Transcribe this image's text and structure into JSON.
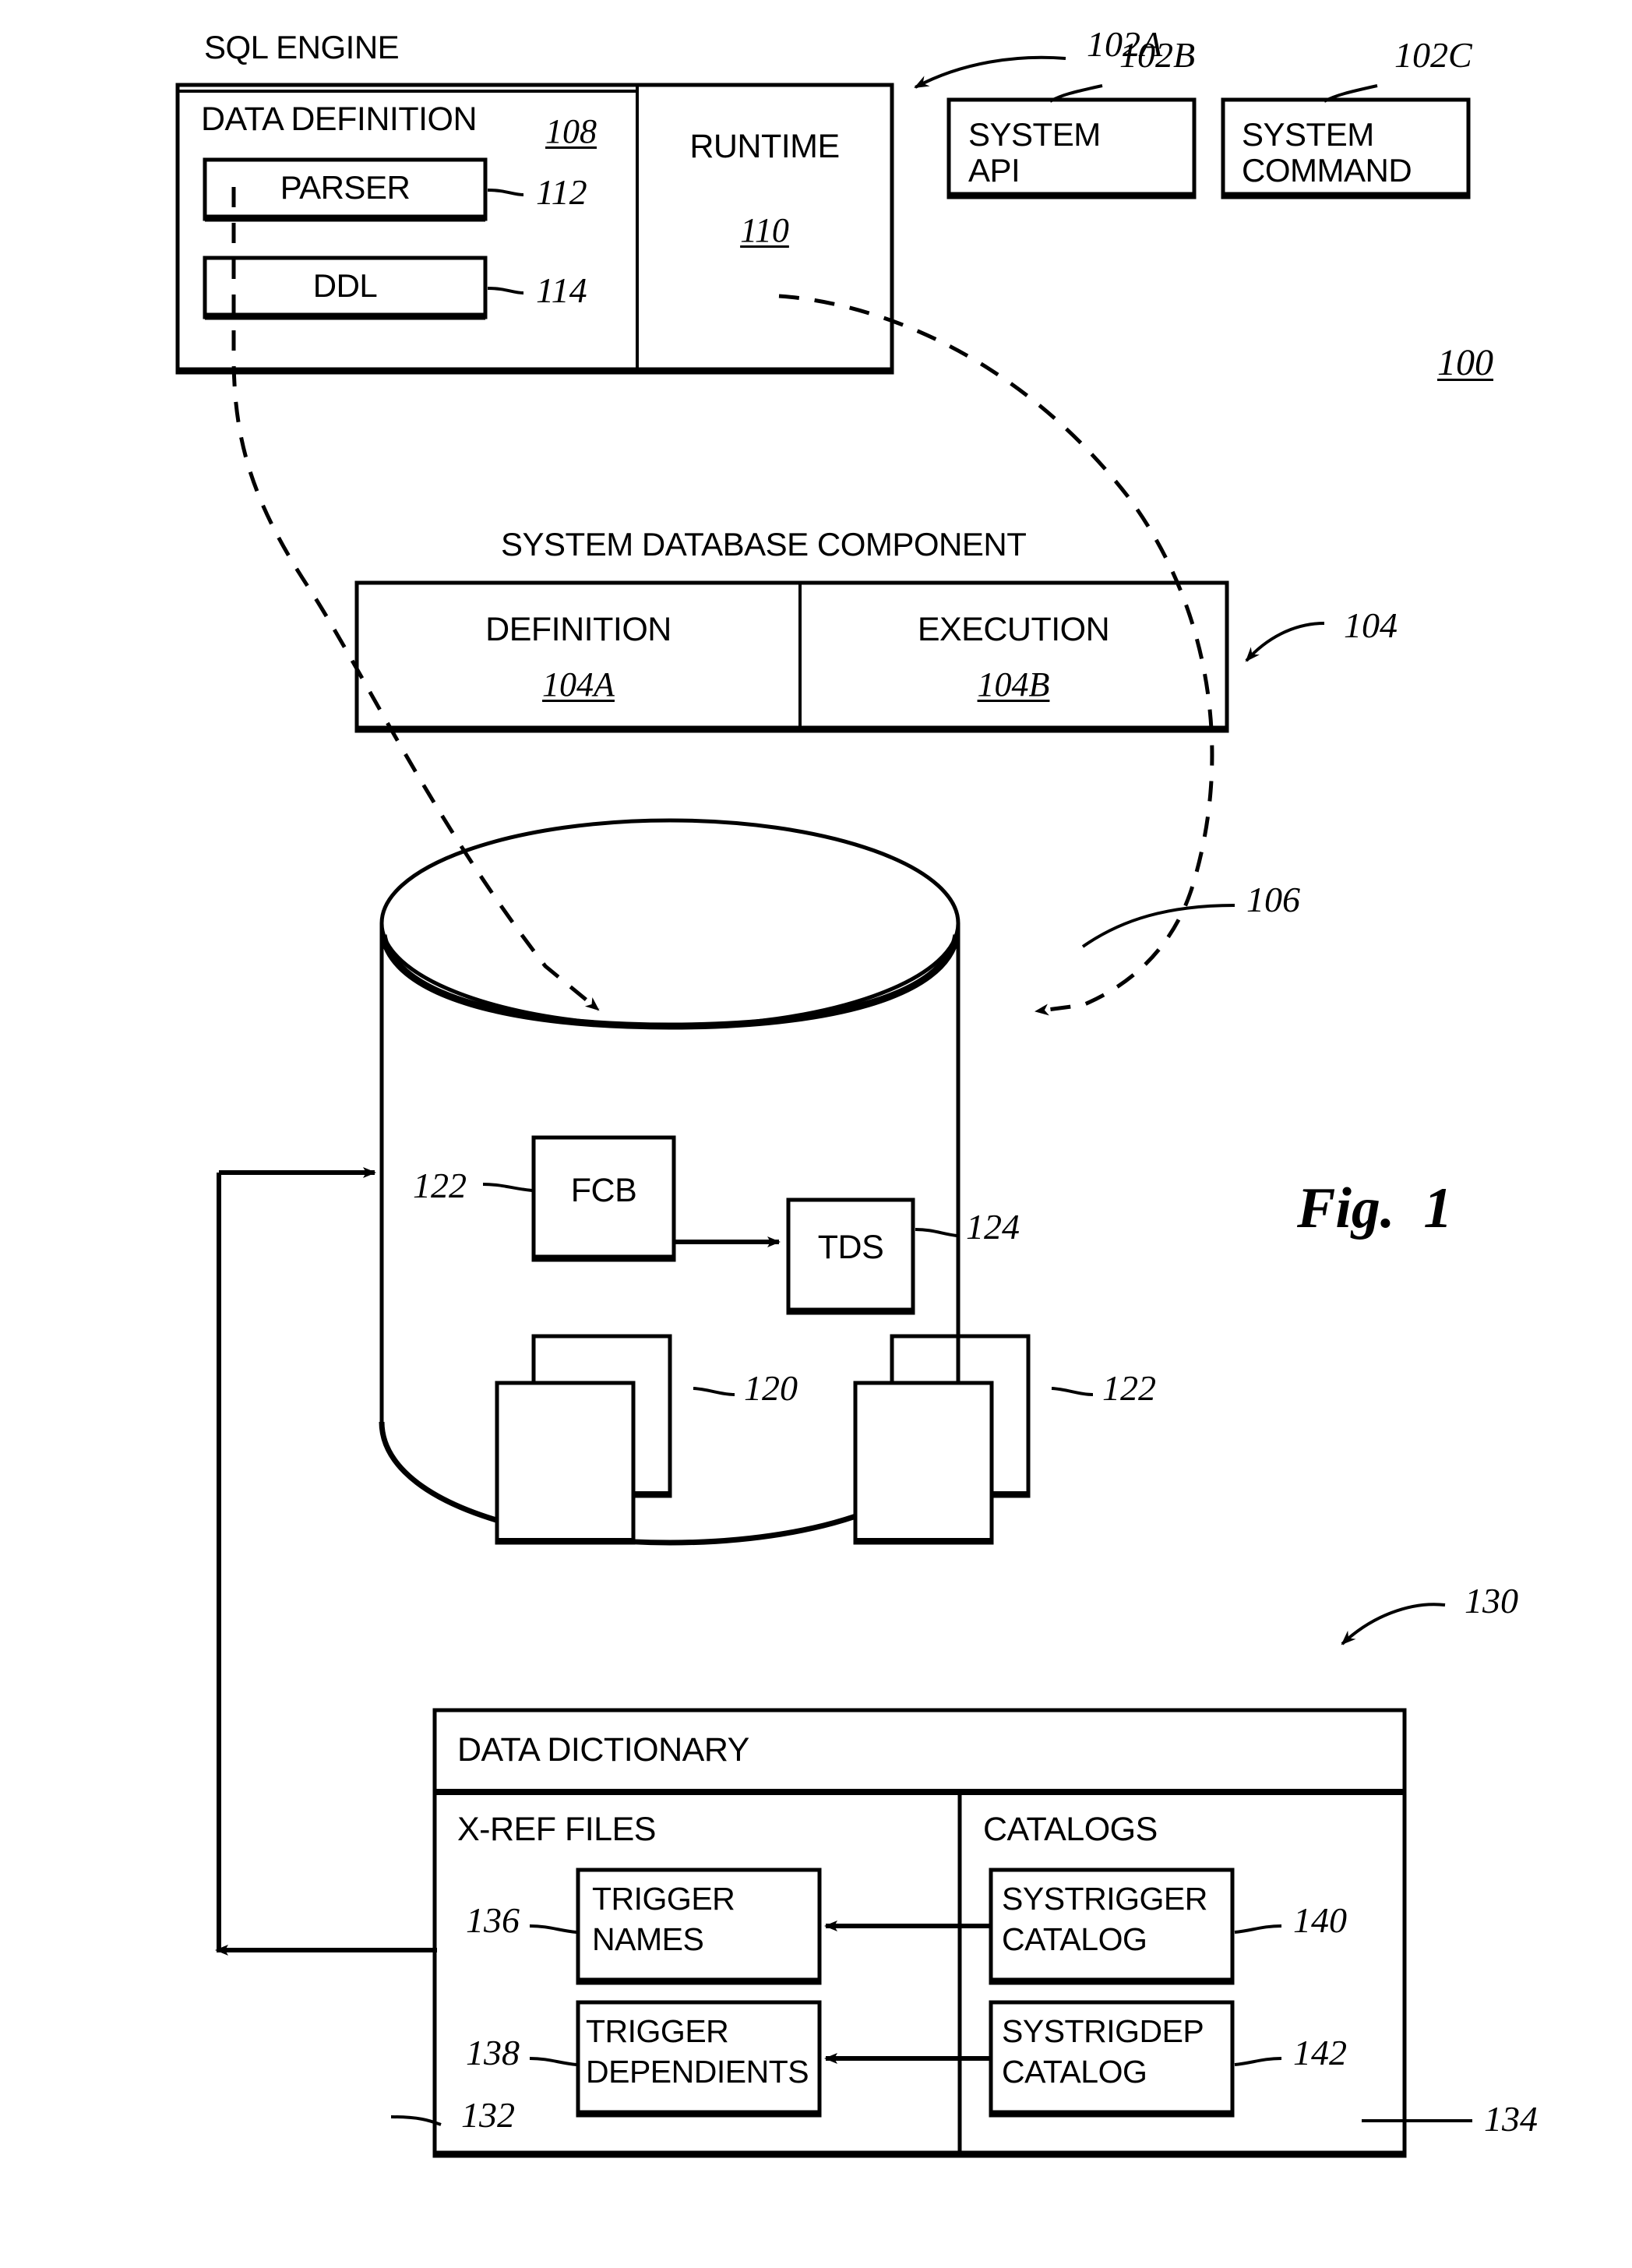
{
  "figure": {
    "caption": "Fig.  1",
    "system_ref": "100"
  },
  "sql_engine": {
    "title": "SQL ENGINE",
    "ref": "102A",
    "data_definition": {
      "title": "DATA DEFINITION",
      "ref": "108",
      "parser": {
        "label": "PARSER",
        "ref": "112"
      },
      "ddl": {
        "label": "DDL",
        "ref": "114"
      }
    },
    "runtime": {
      "label": "RUNTIME",
      "ref": "110"
    }
  },
  "peers": [
    {
      "line1": "SYSTEM",
      "line2": "API",
      "ref": "102B"
    },
    {
      "line1": "SYSTEM",
      "line2": "COMMAND",
      "ref": "102C"
    }
  ],
  "system_database_component": {
    "title": "SYSTEM DATABASE COMPONENT",
    "ref": "104",
    "cells": [
      {
        "label": "DEFINITION",
        "ref": "104A"
      },
      {
        "label": "EXECUTION",
        "ref": "104B"
      }
    ]
  },
  "database_cylinder": {
    "ref": "106",
    "fcb": {
      "label": "FCB",
      "ref": "122"
    },
    "tds": {
      "label": "TDS",
      "ref": "124"
    },
    "stack_left_ref": "120",
    "stack_right_ref": "122"
  },
  "data_dictionary": {
    "title": "DATA DICTIONARY",
    "ref": "130",
    "xref": {
      "title": "X-REF FILES",
      "ref": "132",
      "items": [
        {
          "line1": "TRIGGER",
          "line2": "NAMES",
          "ref": "136"
        },
        {
          "line1": "TRIGGER",
          "line2": "DEPENDIENTS",
          "ref": "138"
        }
      ]
    },
    "catalogs": {
      "title": "CATALOGS",
      "ref": "134",
      "items": [
        {
          "line1": "SYSTRIGGER",
          "line2": "CATALOG",
          "ref": "140"
        },
        {
          "line1": "SYSTRIGDEP",
          "line2": "CATALOG",
          "ref": "142"
        }
      ]
    }
  }
}
